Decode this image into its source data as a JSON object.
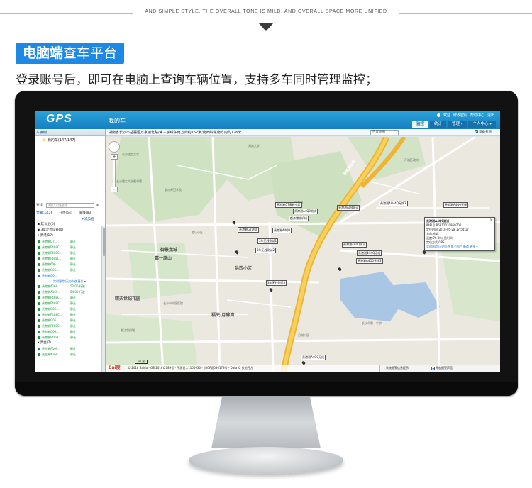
{
  "banner": {
    "tagline": "AND SIMPLE STYLE, THE OVERALL TONE IS MILD, AND OVERALL SPACE MORE UNIFIED",
    "badge_bold": "电脑端",
    "badge_light": "查车平台",
    "subtitle": "登录账号后，即可在电脑上查询车辆位置，支持多车同时管理监控；"
  },
  "app": {
    "logo": "GPS",
    "title": "我的车",
    "user_links": [
      "欢迎",
      "修改密码",
      "帮助中心",
      "退出"
    ],
    "nav_tabs": [
      {
        "label": "监控",
        "active": true
      },
      {
        "label": "统计",
        "active": false
      },
      {
        "label": "管理 ▾",
        "active": false
      },
      {
        "label": "个人中心 ▾",
        "active": false
      }
    ],
    "address": "湖南省长沙市岳麓区万家丽北路/第三学缘东南方向约152米;南西岭东南方向约176米",
    "map_type": "百度地图",
    "show_marker_label": "设备名称"
  },
  "sidebar": {
    "header": "车辆树",
    "root": "我的车(147/147)",
    "search_label": "查找",
    "search_placeholder": "请输入设备名称",
    "search_clear": "×",
    "status_tabs": [
      {
        "label": "全部(147)",
        "active": true
      },
      {
        "label": "在线(64)",
        "active": false
      },
      {
        "label": "离线(83)",
        "active": false
      }
    ],
    "add_group": "+添加组",
    "groups": [
      {
        "title": "▪ 默认组(0)",
        "vehicles": []
      },
      {
        "title": "▪ 3年定位设备(0)",
        "vehicles": []
      },
      {
        "title": "▾ 贵港(17)",
        "vehicles": [
          {
            "name": "贵港湘G7...",
            "status": "静止",
            "color": "green"
          },
          {
            "name": "贵港湘F488C...",
            "status": "静止",
            "color": "green"
          },
          {
            "name": "贵港湘F488C...",
            "status": "静止",
            "color": "green"
          },
          {
            "name": "贵港湘F488C...",
            "status": "静止",
            "color": "green"
          },
          {
            "name": "贵港湘606...",
            "status": "静止",
            "color": "green"
          },
          {
            "name": "贵港湘G06...",
            "status": "静止",
            "color": "green"
          },
          {
            "name": "贵港湘G0...",
            "status": "",
            "color": "blue"
          }
        ]
      },
      {
        "title": "",
        "sub_links": "实时跟踪 历史轨迹 更多 ▾",
        "vehicles": [
          {
            "name": "贵港湘A169...",
            "status": "52.00 行驶",
            "color": "green"
          },
          {
            "name": "贵港湘A169...",
            "status": "64.00 行驶",
            "color": "green"
          },
          {
            "name": "贵港湘F488C...",
            "status": "静止",
            "color": "green"
          },
          {
            "name": "贵港湘F488C...",
            "status": "静止",
            "color": "green"
          },
          {
            "name": "贵港湘G06...",
            "status": "静止",
            "color": "green"
          },
          {
            "name": "贵港湘F488C...",
            "status": "静止",
            "color": "green"
          },
          {
            "name": "贵港湘G06...",
            "status": "静止",
            "color": "green"
          },
          {
            "name": "贵港湘F488C...",
            "status": "静止",
            "color": "green"
          },
          {
            "name": "贵港湘G06...",
            "status": "静止",
            "color": "green"
          },
          {
            "name": "贵港湘F488C...",
            "status": "静止",
            "color": "green"
          }
        ]
      },
      {
        "title": "▾ 贵金(7)",
        "vehicles": [
          {
            "name": "贵金湘A169...",
            "status": "静止",
            "color": "green"
          },
          {
            "name": "贵金湘A169...",
            "status": "静止",
            "color": "green"
          },
          {
            "name": "贵金湘A169...",
            "status": "静止",
            "color": "green"
          }
        ]
      }
    ]
  },
  "map": {
    "district_labels": [
      "御景龙城",
      "嘉一原山",
      "晴天世纪花园",
      "福天·月醉湾",
      "洪西小区",
      "芙蓉湾东路"
    ],
    "street_labels": [
      "长沙理工大学",
      "长沙理工大学图书馆",
      "长沙师范学院",
      "湖南大学",
      "长沙市中医医院",
      "月湖公园",
      "广汉体育馆",
      "丽景园",
      "金坛小区",
      "湘江世纪城",
      "长沙市第一中学",
      "开福区政府"
    ],
    "vehicle_labels": [
      "贵港湘G7泉眼小区",
      "贵港湘A4Q0测试",
      "起点储物机械",
      "贵港湘4AH4Q无线3",
      "贵港湘A4Q0无线",
      "贵港湘A4QB",
      "贵港湘G7测试",
      "3年无线测试1",
      "贵港湘AQ4测试",
      "3年无线测试2",
      "3年无线测试3",
      "贵港湘4H4Q测试",
      "贵港湘4H4Q无线",
      "贵港湘A4Q0无线3",
      "贵港湘A4Q0无线"
    ],
    "popup": {
      "title": "贵港湘A4Q0测试",
      "imei": "IMEI号:86812010960702",
      "locate_time": "定位时间:2018-05-28 17:54:17",
      "direction": "方向:东北",
      "speed": "速度:76.00公里/小时",
      "mode": "定位方式:GPS",
      "links": "实时跟踪 历史轨迹 电子围栏 街道 更多 ▾",
      "close": "×"
    },
    "baidu": "Bai度",
    "copyright": "© 2018 Baidu - GS(2016)2089号 - 甲测资字1100930 - 京ICP证030173号 - Data © 长地万方",
    "scale": "50 米",
    "alarm_label": "系统报警信息提示",
    "alarm_open": "开启报警声音"
  }
}
